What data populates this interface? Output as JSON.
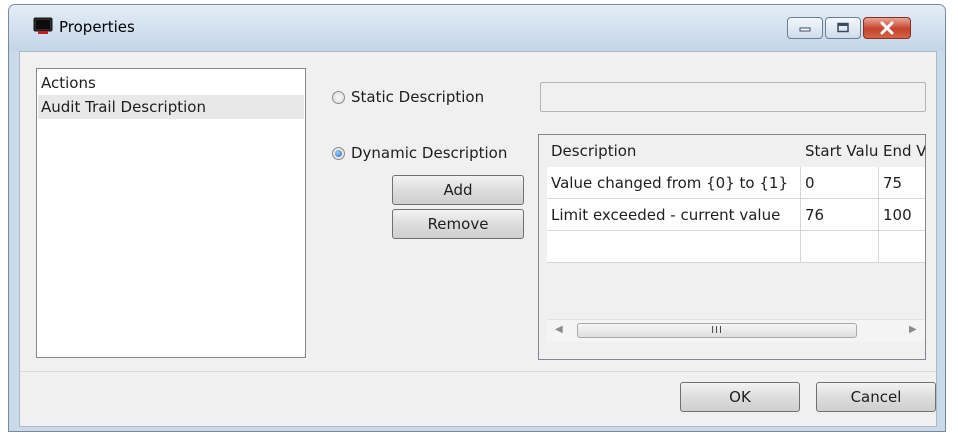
{
  "window": {
    "title": "Properties",
    "icons": {
      "app": "monitor-icon",
      "minimize": "minimize-icon",
      "maximize": "maximize-icon",
      "close": "close-icon"
    },
    "colors": {
      "close_button": "#c5432b",
      "selection": "#e8e8e8"
    }
  },
  "nav": {
    "items": [
      {
        "label": "Actions",
        "selected": false
      },
      {
        "label": "Audit Trail Description",
        "selected": true
      }
    ]
  },
  "description": {
    "static_label": "Static Description",
    "static_value": "",
    "dynamic_label": "Dynamic Description",
    "selected_mode": "dynamic",
    "add_label": "Add",
    "remove_label": "Remove"
  },
  "grid": {
    "columns": [
      "Description",
      "Start Valu",
      "End V"
    ],
    "rows": [
      [
        "Value changed from {0} to {1}",
        "0",
        "75"
      ],
      [
        "Limit exceeded - current value",
        "76",
        "100"
      ],
      [
        "",
        "",
        ""
      ]
    ],
    "scroll_thumb_glyph": "III",
    "scroll_left_glyph": "◀",
    "scroll_right_glyph": "▶"
  },
  "footer": {
    "ok_label": "OK",
    "cancel_label": "Cancel"
  }
}
